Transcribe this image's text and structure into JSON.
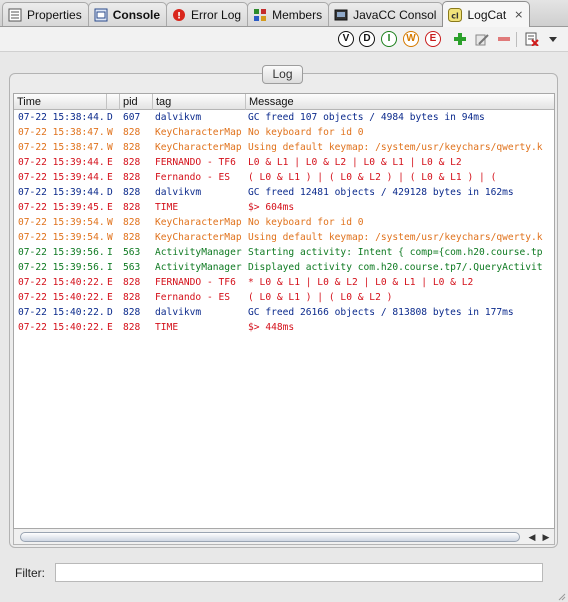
{
  "tabs": [
    {
      "label": "Properties",
      "icon": "properties-icon",
      "active": false,
      "bold": false
    },
    {
      "label": "Console",
      "icon": "console-icon",
      "active": false,
      "bold": true
    },
    {
      "label": "Error Log",
      "icon": "error-log-icon",
      "active": false,
      "bold": false
    },
    {
      "label": "Members",
      "icon": "members-icon",
      "active": false,
      "bold": false
    },
    {
      "label": "JavaCC Consol",
      "icon": "javacc-console-icon",
      "active": false,
      "bold": false
    },
    {
      "label": "LogCat",
      "icon": "logcat-icon",
      "active": true,
      "bold": false,
      "close": "⨯"
    }
  ],
  "toolbar": {
    "verbose": "V",
    "debug": "D",
    "info": "I",
    "warn": "W",
    "error": "E"
  },
  "log_button": "Log",
  "table": {
    "headers": [
      "Time",
      "",
      "pid",
      "tag",
      "Message"
    ],
    "rows": [
      {
        "time": "07-22 15:38:44.",
        "level": "D",
        "pid": "607",
        "tag": "dalvikvm",
        "message": "GC freed 107 objects / 4984 bytes in 94ms"
      },
      {
        "time": "07-22 15:38:47.",
        "level": "W",
        "pid": "828",
        "tag": "KeyCharacterMap",
        "message": "No keyboard for id 0"
      },
      {
        "time": "07-22 15:38:47.",
        "level": "W",
        "pid": "828",
        "tag": "KeyCharacterMap",
        "message": "Using default keymap: /system/usr/keychars/qwerty.k"
      },
      {
        "time": "07-22 15:39:44.",
        "level": "E",
        "pid": "828",
        "tag": "FERNANDO - TF6",
        "message": "L0 & L1 | L0 & L2 | L0 & L1 | L0 & L2"
      },
      {
        "time": "07-22 15:39:44.",
        "level": "E",
        "pid": "828",
        "tag": "Fernando - ES",
        "message": "( L0 & L1 )  |  ( L0 & L2 )  |  ( L0 & L1 )  |  ("
      },
      {
        "time": "07-22 15:39:44.",
        "level": "D",
        "pid": "828",
        "tag": "dalvikvm",
        "message": "GC freed 12481 objects / 429128 bytes in 162ms"
      },
      {
        "time": "07-22 15:39:45.",
        "level": "E",
        "pid": "828",
        "tag": "TIME",
        "message": "$> 604ms"
      },
      {
        "time": "07-22 15:39:54.",
        "level": "W",
        "pid": "828",
        "tag": "KeyCharacterMap",
        "message": "No keyboard for id 0"
      },
      {
        "time": "07-22 15:39:54.",
        "level": "W",
        "pid": "828",
        "tag": "KeyCharacterMap",
        "message": "Using default keymap: /system/usr/keychars/qwerty.k"
      },
      {
        "time": "07-22 15:39:56.",
        "level": "I",
        "pid": "563",
        "tag": "ActivityManager",
        "message": "Starting activity: Intent { comp={com.h20.course.tp"
      },
      {
        "time": "07-22 15:39:56.",
        "level": "I",
        "pid": "563",
        "tag": "ActivityManager",
        "message": "Displayed activity com.h20.course.tp7/.QueryActivit"
      },
      {
        "time": "07-22 15:40:22.",
        "level": "E",
        "pid": "828",
        "tag": "FERNANDO - TF6",
        "message": "* L0 & L1 | L0 & L2 | L0 & L1 | L0 & L2"
      },
      {
        "time": "07-22 15:40:22.",
        "level": "E",
        "pid": "828",
        "tag": "Fernando - ES",
        "message": "( L0 & L1 )  |  ( L0 & L2 )"
      },
      {
        "time": "07-22 15:40:22.",
        "level": "D",
        "pid": "828",
        "tag": "dalvikvm",
        "message": "GC freed 26166 objects / 813808 bytes in 177ms"
      },
      {
        "time": "07-22 15:40:22.",
        "level": "E",
        "pid": "828",
        "tag": "TIME",
        "message": "$> 448ms"
      }
    ]
  },
  "filter": {
    "label": "Filter:",
    "value": ""
  },
  "colors": {
    "debug": "#0b2a8c",
    "warn": "#e0721c",
    "error": "#d4101a",
    "info": "#0f7a22"
  }
}
